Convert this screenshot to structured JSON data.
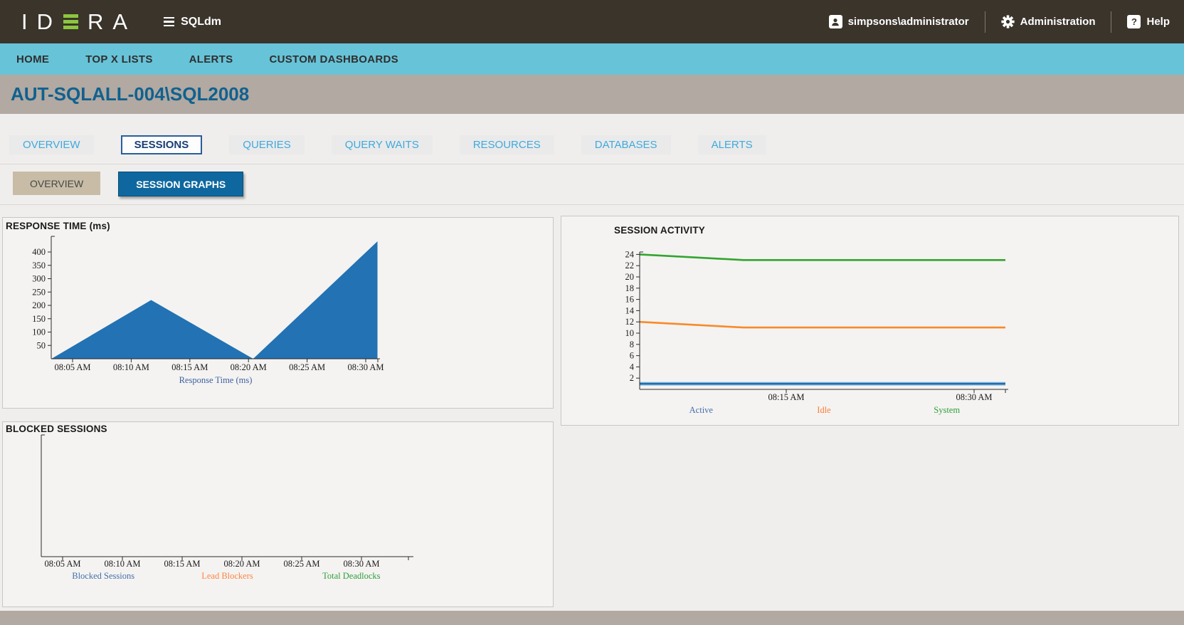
{
  "header": {
    "logo_left": "ID",
    "logo_right": "RA",
    "menu_label": "SQLdm",
    "user": "simpsons\\administrator",
    "administration": "Administration",
    "help": "Help",
    "help_glyph": "?"
  },
  "nav": {
    "items": [
      "HOME",
      "TOP X LISTS",
      "ALERTS",
      "CUSTOM DASHBOARDS"
    ]
  },
  "page_title": "AUT-SQLALL-004\\SQL2008",
  "tabs": [
    {
      "label": "OVERVIEW",
      "active": false
    },
    {
      "label": "SESSIONS",
      "active": true
    },
    {
      "label": "QUERIES",
      "active": false
    },
    {
      "label": "QUERY WAITS",
      "active": false
    },
    {
      "label": "RESOURCES",
      "active": false
    },
    {
      "label": "DATABASES",
      "active": false
    },
    {
      "label": "ALERTS",
      "active": false
    }
  ],
  "subtabs": [
    {
      "label": "OVERVIEW",
      "active": false
    },
    {
      "label": "SESSION GRAPHS",
      "active": true
    }
  ],
  "chart_data": [
    {
      "id": "response-time",
      "type": "area",
      "title": "RESPONSE TIME (ms)",
      "xlabel": "Response Time (ms)",
      "xlabel_color": "#3c5f9f",
      "x_ticks": [
        "08:05 AM",
        "08:10 AM",
        "08:15 AM",
        "08:20 AM",
        "08:25 AM",
        "08:30 AM"
      ],
      "x_tick_minutes": [
        5,
        10,
        15,
        20,
        25,
        30
      ],
      "y_ticks": [
        50,
        100,
        150,
        200,
        250,
        300,
        350,
        400
      ],
      "ylim": [
        0,
        450
      ],
      "grid": false,
      "series": [
        {
          "name": "Response Time (ms)",
          "color": "#2272b4",
          "x_minutes": [
            3.2,
            11.7,
            20.4,
            31.0
          ],
          "values": [
            0,
            220,
            0,
            440
          ]
        }
      ],
      "legend": []
    },
    {
      "id": "session-activity",
      "type": "line",
      "title": "SESSION ACTIVITY",
      "x_ticks": [
        "08:15 AM",
        "08:30 AM"
      ],
      "x_tick_minutes": [
        15,
        30
      ],
      "y_ticks": [
        2,
        4,
        6,
        8,
        10,
        12,
        14,
        16,
        18,
        20,
        22,
        24
      ],
      "ylim": [
        0,
        25
      ],
      "grid": false,
      "series": [
        {
          "name": "Active",
          "color": "#1f6fae",
          "halo": "#93bfe0",
          "x_minutes": [
            3.3,
            32.5
          ],
          "values": [
            1,
            1
          ]
        },
        {
          "name": "Idle",
          "color": "#f98a2a",
          "x_minutes": [
            3.3,
            11.6,
            32.5
          ],
          "values": [
            12,
            11,
            11
          ]
        },
        {
          "name": "System",
          "color": "#33a430",
          "x_minutes": [
            3.3,
            11.6,
            32.5
          ],
          "values": [
            24,
            23,
            23
          ]
        }
      ],
      "legend": [
        {
          "label": "Active",
          "color": "#4470ab"
        },
        {
          "label": "Idle",
          "color": "#fd7c36"
        },
        {
          "label": "System",
          "color": "#2f9e3c"
        }
      ]
    },
    {
      "id": "blocked-sessions",
      "type": "line",
      "title": "BLOCKED SESSIONS",
      "x_ticks": [
        "08:05 AM",
        "08:10 AM",
        "08:15 AM",
        "08:20 AM",
        "08:25 AM",
        "08:30 AM"
      ],
      "x_tick_minutes": [
        5,
        10,
        15,
        20,
        25,
        30
      ],
      "y_ticks": [],
      "ylim": [
        0,
        1
      ],
      "grid": false,
      "series": [],
      "legend": [
        {
          "label": "Blocked Sessions",
          "color": "#4470ab"
        },
        {
          "label": "Lead Blockers",
          "color": "#fd8643"
        },
        {
          "label": "Total Deadlocks",
          "color": "#2f9e3c"
        }
      ]
    }
  ]
}
